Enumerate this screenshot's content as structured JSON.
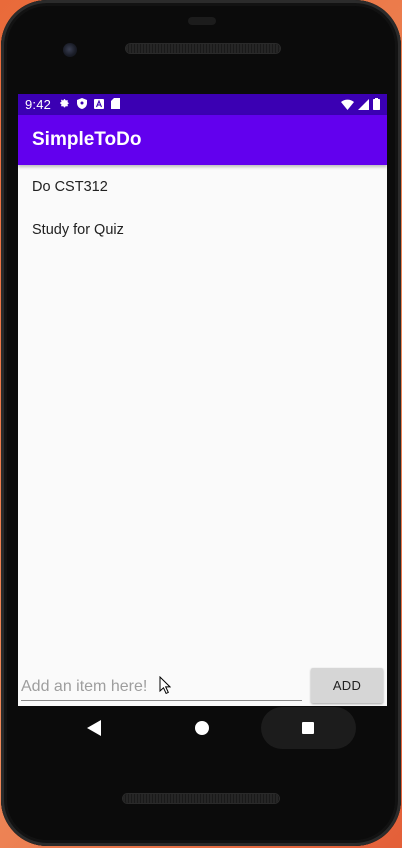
{
  "status_bar": {
    "time": "9:42",
    "left_icons": [
      "gear-icon",
      "shield-icon",
      "font-icon",
      "sd-card-icon"
    ],
    "right_icons": [
      "wifi-icon",
      "cell-signal-icon",
      "battery-icon"
    ],
    "background": "#3b00b3"
  },
  "app_bar": {
    "title": "SimpleToDo",
    "background": "#6200ee"
  },
  "todo_list": {
    "items": [
      {
        "label": "Do CST312"
      },
      {
        "label": "Study for Quiz"
      }
    ]
  },
  "input": {
    "value": "",
    "placeholder": "Add an item here!"
  },
  "add_button": {
    "label": "ADD"
  },
  "nav_bar": {
    "buttons": [
      "back-icon",
      "home-icon",
      "recents-icon"
    ]
  }
}
